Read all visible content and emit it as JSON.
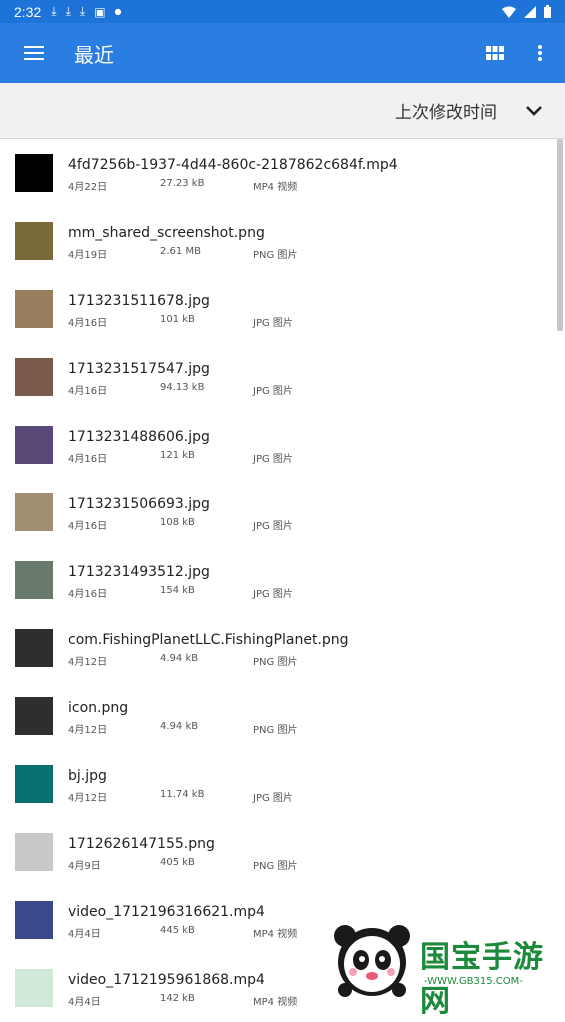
{
  "status_bar": {
    "time": "2:32",
    "notification_icons": [
      "download-icon",
      "download-icon",
      "download-icon",
      "app-icon",
      "dot-icon"
    ],
    "right_icons": [
      "wifi-icon",
      "signal-icon",
      "battery-icon"
    ]
  },
  "app_bar": {
    "title": "最近",
    "actions": [
      "grid-view-icon",
      "more-vert-icon"
    ]
  },
  "sort": {
    "label": "上次修改时间"
  },
  "files": [
    {
      "name": "4fd7256b-1937-4d44-860c-2187862c684f.mp4",
      "date": "4月22日",
      "size": "27.23 kB",
      "type": "MP4 视频",
      "thumb_color": "#000000"
    },
    {
      "name": "mm_shared_screenshot.png",
      "date": "4月19日",
      "size": "2.61 MB",
      "type": "PNG 图片",
      "thumb_color": "#7a6a3a"
    },
    {
      "name": "1713231511678.jpg",
      "date": "4月16日",
      "size": "101 kB",
      "type": "JPG 图片",
      "thumb_color": "#9a7e60"
    },
    {
      "name": "1713231517547.jpg",
      "date": "4月16日",
      "size": "94.13 kB",
      "type": "JPG 图片",
      "thumb_color": "#7a5a4a"
    },
    {
      "name": "1713231488606.jpg",
      "date": "4月16日",
      "size": "121 kB",
      "type": "JPG 图片",
      "thumb_color": "#5a4a7a"
    },
    {
      "name": "1713231506693.jpg",
      "date": "4月16日",
      "size": "108 kB",
      "type": "JPG 图片",
      "thumb_color": "#a09070"
    },
    {
      "name": "1713231493512.jpg",
      "date": "4月16日",
      "size": "154 kB",
      "type": "JPG 图片",
      "thumb_color": "#6a7a6a"
    },
    {
      "name": "com.FishingPlanetLLC.FishingPlanet.png",
      "date": "4月12日",
      "size": "4.94 kB",
      "type": "PNG 图片",
      "thumb_color": "#2e2e2e"
    },
    {
      "name": "icon.png",
      "date": "4月12日",
      "size": "4.94 kB",
      "type": "PNG 图片",
      "thumb_color": "#2e2e2e"
    },
    {
      "name": "bj.jpg",
      "date": "4月12日",
      "size": "11.74 kB",
      "type": "JPG 图片",
      "thumb_color": "#0b7070"
    },
    {
      "name": "1712626147155.png",
      "date": "4月9日",
      "size": "405 kB",
      "type": "PNG 图片",
      "thumb_color": "#c8c8c8"
    },
    {
      "name": "video_1712196316621.mp4",
      "date": "4月4日",
      "size": "445 kB",
      "type": "MP4 视频",
      "thumb_color": "#3a4a8a"
    },
    {
      "name": "video_1712195961868.mp4",
      "date": "4月4日",
      "size": "142 kB",
      "type": "MP4 视频",
      "thumb_color": "#cfe8d8"
    }
  ],
  "watermark": {
    "text": "国宝手游网",
    "url": "-WWW.GB315.COM-"
  }
}
